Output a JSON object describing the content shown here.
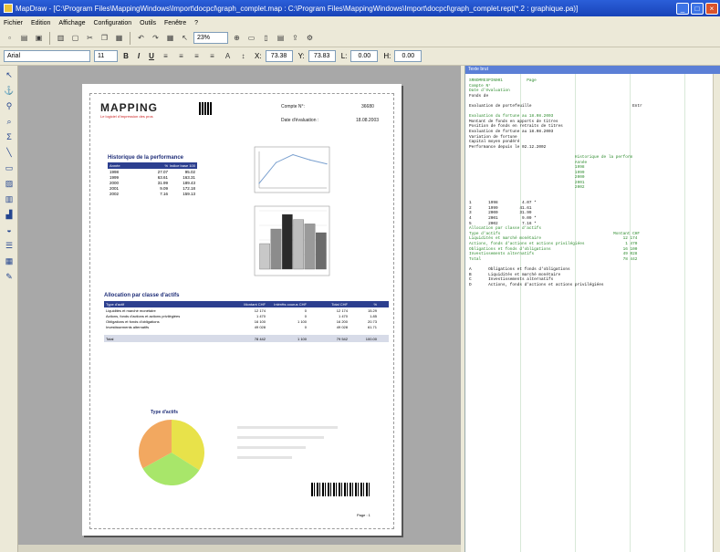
{
  "window": {
    "title": "MapDraw - [C:\\Program Files\\MappingWindows\\Import\\docpcl\\graph_complet.map : C:\\Program Files\\MappingWindows\\Import\\docpcl\\graph_complet.rept(*.2 : graphique.pa)]",
    "controls": [
      "_",
      "□",
      "×"
    ]
  },
  "menu": [
    "Fichier",
    "Edition",
    "Affichage",
    "Configuration",
    "Outils",
    "Fenêtre",
    "?"
  ],
  "toolbar": {
    "zoom": "23%"
  },
  "format_bar": {
    "font": "Arial",
    "size": "11",
    "bold": "B",
    "italic": "I",
    "underline": "U",
    "x_label": "X:",
    "x_value": "73.38",
    "y_label": "Y:",
    "y_value": "73.83",
    "l_label": "L:",
    "l_value": "0.00",
    "h_label": "H:",
    "h_value": "0.00"
  },
  "page": {
    "logo": "MAPPING",
    "logo_sub": "Le logiciel d'impression des pros",
    "compte_label": "Compte N°:",
    "compte_value": "36680",
    "date_label": "Date d'évaluation :",
    "date_value": "18.08.2003",
    "perf_title": "Historique de la performance",
    "perf_headers": [
      "Année",
      "%",
      "Indice base 100"
    ],
    "perf_rows": [
      [
        "1998",
        "27.07",
        "95.02"
      ],
      [
        "1999",
        "63.61",
        "163.31"
      ],
      [
        "2000",
        "31.99",
        "189.43"
      ],
      [
        "2001",
        "9.09",
        "172.18"
      ],
      [
        "2002",
        "7.16",
        "159.13"
      ]
    ],
    "alloc_title": "Allocation par classe d'actifs",
    "alloc_headers": [
      "Type d'actif",
      "Montant CHF",
      "Intérêts courus CHF",
      "Total CHF",
      "%"
    ],
    "alloc_rows": [
      [
        "Liquidités et marché monétaire",
        "12 174",
        "0",
        "12 174",
        "15.29"
      ],
      [
        "Actions, fonds d'actions et actions privilégiées",
        "1 470",
        "0",
        "1 470",
        "1.85"
      ],
      [
        "Obligations et fonds d'obligations",
        "16 100",
        "1 100",
        "16 200",
        "20.73"
      ],
      [
        "Investissements alternatifs",
        "49 028",
        "0",
        "49 028",
        "61.71"
      ]
    ],
    "alloc_total": [
      "Total",
      "78 442",
      "1 100",
      "79 542",
      "100.00"
    ],
    "pie_title": "Type d'actifs",
    "footer": "Page : 1"
  },
  "text_panel": {
    "title": "Texte brut",
    "lines": [
      {
        "t": "SRNOMRESPIN001          Page",
        "c": "green"
      },
      {
        "t": "Compte N°",
        "c": "green"
      },
      {
        "t": "Date d'évaluation",
        "c": "green"
      },
      {
        "t": "Fonds de",
        "c": "black"
      },
      {
        "t": "",
        "c": "black"
      },
      {
        "t": "Evaluation de portefeuille                                          Entr",
        "c": "black"
      },
      {
        "t": "",
        "c": "black"
      },
      {
        "t": "Evaluation du fortune au 18.08.2003",
        "c": "green"
      },
      {
        "t": "Montant de fonds en apports de titres",
        "c": "black"
      },
      {
        "t": "Position de fonds en retraits de titres",
        "c": "black"
      },
      {
        "t": "Evaluation de fortune au 18.08.2003",
        "c": "black"
      },
      {
        "t": "Variation de fortune",
        "c": "black"
      },
      {
        "t": "Capital moyen pondéré",
        "c": "black"
      },
      {
        "t": "Performance depuis le 02.12.2002",
        "c": "black"
      },
      {
        "t": "",
        "c": "black"
      },
      {
        "t": "                                            Historique de la perform",
        "c": "green"
      },
      {
        "t": "                                            Année",
        "c": "green"
      },
      {
        "t": "                                            1998",
        "c": "green"
      },
      {
        "t": "                                            1999",
        "c": "green"
      },
      {
        "t": "                                            2000",
        "c": "green"
      },
      {
        "t": "                                            2001",
        "c": "green"
      },
      {
        "t": "                                            2002",
        "c": "green"
      },
      {
        "t": "",
        "c": "black"
      },
      {
        "t": "",
        "c": "black"
      },
      {
        "t": "1       1998          4.07 *",
        "c": "black"
      },
      {
        "t": "2       1999         41.61",
        "c": "black"
      },
      {
        "t": "3       2000         31.99",
        "c": "black"
      },
      {
        "t": "4       2001          9.09 *",
        "c": "black"
      },
      {
        "t": "5       2002          7.16 *",
        "c": "black"
      },
      {
        "t": "Allocation par classe d'actifs",
        "c": "green"
      },
      {
        "t": "Type d'actifs                                               Montant CHF",
        "c": "green"
      },
      {
        "t": "Liquidités et marché monétaire                                  12 174",
        "c": "green"
      },
      {
        "t": "Actions, fonds d'actions et actions privilégiées                 1 470",
        "c": "green"
      },
      {
        "t": "Obligations et fonds d'obligations                              16 100",
        "c": "green"
      },
      {
        "t": "Investissements alternatifs                                     49 028",
        "c": "green"
      },
      {
        "t": "Total                                                           78 442",
        "c": "green"
      },
      {
        "t": "",
        "c": "black"
      },
      {
        "t": "A       Obligations et fonds d'obligations",
        "c": "black"
      },
      {
        "t": "B       Liquidités et marché monétaire",
        "c": "black"
      },
      {
        "t": "C       Investissements alternatifs",
        "c": "black"
      },
      {
        "t": "D       Actions, fonds d'actions et actions privilégiées",
        "c": "black"
      }
    ]
  },
  "chart_data": [
    {
      "type": "line",
      "x": [
        "1998",
        "1999",
        "2000",
        "2001",
        "2002"
      ],
      "series": [
        {
          "values": [
            95.02,
            163.31,
            189.43,
            172.18,
            159.13
          ]
        }
      ],
      "ylim": [
        80,
        200
      ]
    },
    {
      "type": "bar",
      "categories": [
        "1",
        "2",
        "3",
        "4",
        "5",
        "6"
      ],
      "values": [
        35,
        55,
        75,
        68,
        62,
        50
      ],
      "ylim": [
        0,
        80
      ],
      "colors": [
        "#c8c8c8",
        "#8c8c8c",
        "#2a2a2a",
        "#bdbdbd",
        "#9a9a9a",
        "#6b6b6b"
      ]
    },
    {
      "type": "pie",
      "values": [
        34,
        33,
        33
      ],
      "colors": [
        "#e8e24a",
        "#a8e66a",
        "#f2a860"
      ]
    }
  ]
}
